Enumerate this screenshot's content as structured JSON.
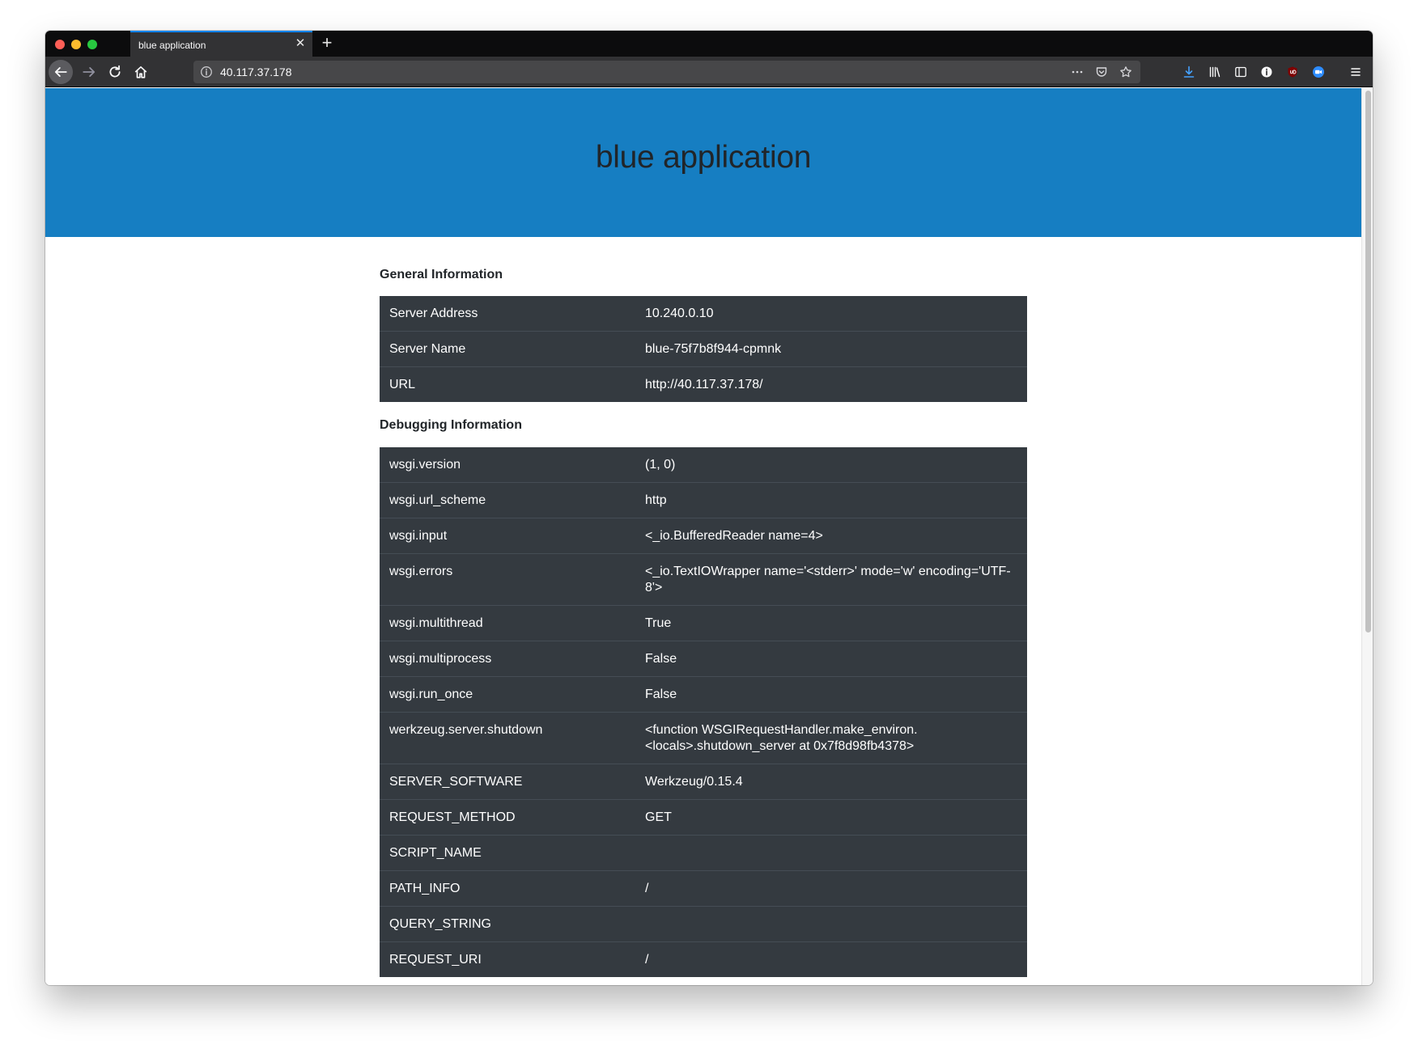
{
  "browser": {
    "tab_title": "blue application",
    "url": "40.117.37.178"
  },
  "page": {
    "title": "blue application",
    "general_heading": "General Information",
    "general_rows": [
      {
        "key": "Server Address",
        "value": "10.240.0.10"
      },
      {
        "key": "Server Name",
        "value": "blue-75f7b8f944-cpmnk"
      },
      {
        "key": "URL",
        "value": "http://40.117.37.178/"
      }
    ],
    "debug_heading": "Debugging Information",
    "debug_rows": [
      {
        "key": "wsgi.version",
        "value": "(1, 0)"
      },
      {
        "key": "wsgi.url_scheme",
        "value": "http"
      },
      {
        "key": "wsgi.input",
        "value": "<_io.BufferedReader name=4>"
      },
      {
        "key": "wsgi.errors",
        "value": "<_io.TextIOWrapper name='<stderr>' mode='w' encoding='UTF-8'>"
      },
      {
        "key": "wsgi.multithread",
        "value": "True"
      },
      {
        "key": "wsgi.multiprocess",
        "value": "False"
      },
      {
        "key": "wsgi.run_once",
        "value": "False"
      },
      {
        "key": "werkzeug.server.shutdown",
        "value": "<function WSGIRequestHandler.make_environ.<locals>.shutdown_server at 0x7f8d98fb4378>"
      },
      {
        "key": "SERVER_SOFTWARE",
        "value": "Werkzeug/0.15.4"
      },
      {
        "key": "REQUEST_METHOD",
        "value": "GET"
      },
      {
        "key": "SCRIPT_NAME",
        "value": ""
      },
      {
        "key": "PATH_INFO",
        "value": "/"
      },
      {
        "key": "QUERY_STRING",
        "value": ""
      },
      {
        "key": "REQUEST_URI",
        "value": "/"
      }
    ]
  },
  "colors": {
    "hero": "#167ec2",
    "table_bg": "#343a40",
    "tab_accent": "#0a84ff"
  }
}
